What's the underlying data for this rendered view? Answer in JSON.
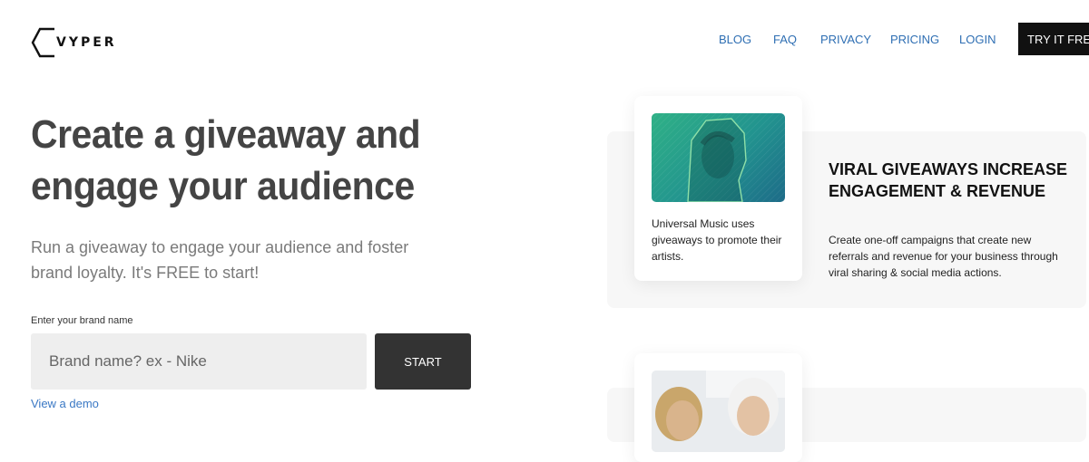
{
  "header": {
    "logo_text": "VYPER",
    "nav": [
      {
        "label": "BLOG"
      },
      {
        "label": "FAQ"
      },
      {
        "label": "PRIVACY"
      },
      {
        "label": "PRICING"
      },
      {
        "label": "LOGIN"
      }
    ],
    "cta_label": "TRY IT FREE"
  },
  "hero": {
    "title": "Create a giveaway and engage your audience",
    "subtitle": "Run a giveaway to engage your audience and foster brand loyalty. It's FREE to start!",
    "brand_label": "Enter your brand name",
    "brand_placeholder": "Brand name? ex - Nike",
    "start_label": "START",
    "demo_link": "View a demo"
  },
  "features": [
    {
      "card_caption": "Universal Music uses giveaways to promote their artists.",
      "title": "VIRAL GIVEAWAYS INCREASE ENGAGEMENT & REVENUE",
      "description": "Create one-off campaigns that create new referrals and revenue for your business through viral sharing & social media actions."
    }
  ],
  "colors": {
    "accent_link": "#2f6fb3",
    "cta_bg": "#111111",
    "start_bg": "#333333",
    "card_gradient_start": "#2fb186",
    "card_gradient_end": "#1d6b88"
  },
  "icons": [
    "vyper-logo-icon"
  ]
}
